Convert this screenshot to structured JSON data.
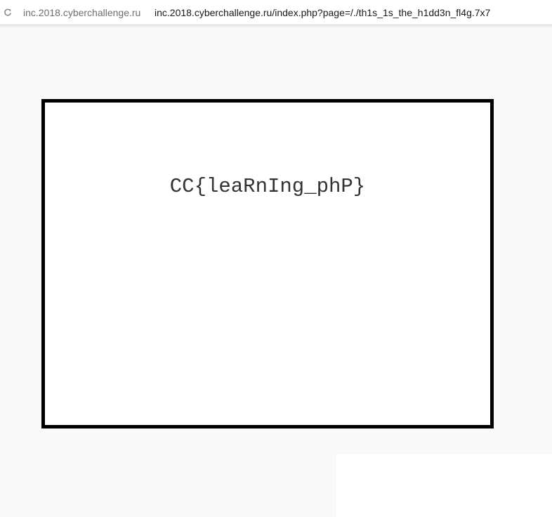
{
  "browser": {
    "domain": "inc.2018.cyberchallenge.ru",
    "url": "inc.2018.cyberchallenge.ru/index.php?page=/./th1s_1s_the_h1dd3n_fl4g.7x7",
    "reload_icon": "reload-icon"
  },
  "page": {
    "flag": "CC{leaRnIng_phP}",
    "box_border_color": "#000000",
    "background_color": "#f9f9f9"
  }
}
